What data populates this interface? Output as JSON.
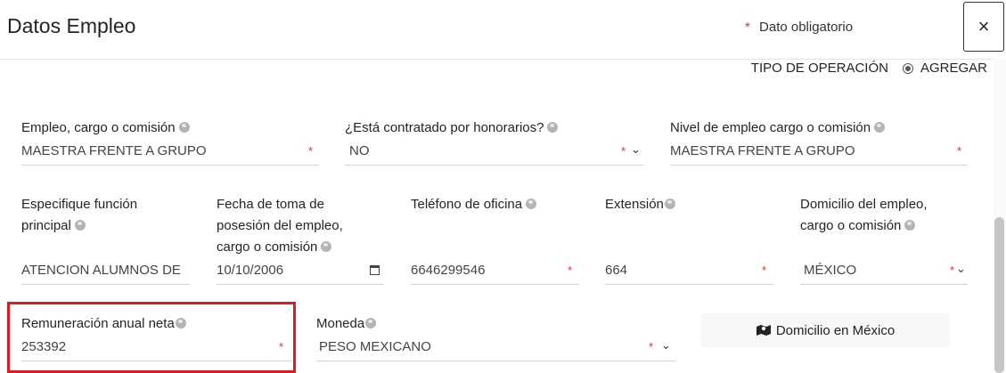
{
  "header": {
    "title": "Datos Empleo",
    "required_note": "Dato obligatorio",
    "close_label": "×"
  },
  "operation": {
    "label": "TIPO DE OPERACIÓN",
    "value": "AGREGAR"
  },
  "fields": {
    "empleo": {
      "label": "Empleo, cargo o comisión",
      "value": "MAESTRA FRENTE A GRUPO"
    },
    "honorarios": {
      "label": "¿Está contratado por honorarios?",
      "value": "NO"
    },
    "nivel": {
      "label": "Nivel de empleo cargo o comisión",
      "value": "MAESTRA FRENTE A GRUPO"
    },
    "funcion": {
      "label_line1": "Especifique función",
      "label_line2": "principal",
      "value": "ATENCION ALUMNOS DE"
    },
    "fecha": {
      "label_line1": "Fecha de toma de",
      "label_line2": "posesión del empleo,",
      "label_line3": "cargo o comisión",
      "value": "10/10/2006"
    },
    "telefono": {
      "label": "Teléfono de oficina",
      "value": "6646299546"
    },
    "extension": {
      "label": "Extensión",
      "value": "664"
    },
    "domicilio": {
      "label_line1": "Domicilio del empleo,",
      "label_line2": "cargo o comisión",
      "value": "MÉXICO"
    },
    "remuneracion": {
      "label": "Remuneración anual neta",
      "value": "253392"
    },
    "moneda": {
      "label": "Moneda",
      "value": "PESO MEXICANO"
    }
  },
  "domicilio_button": {
    "label": "Domicilio en México"
  },
  "colors": {
    "required": "#e3342f",
    "highlight": "#e01b24",
    "button_bg": "#f7f7f7"
  }
}
